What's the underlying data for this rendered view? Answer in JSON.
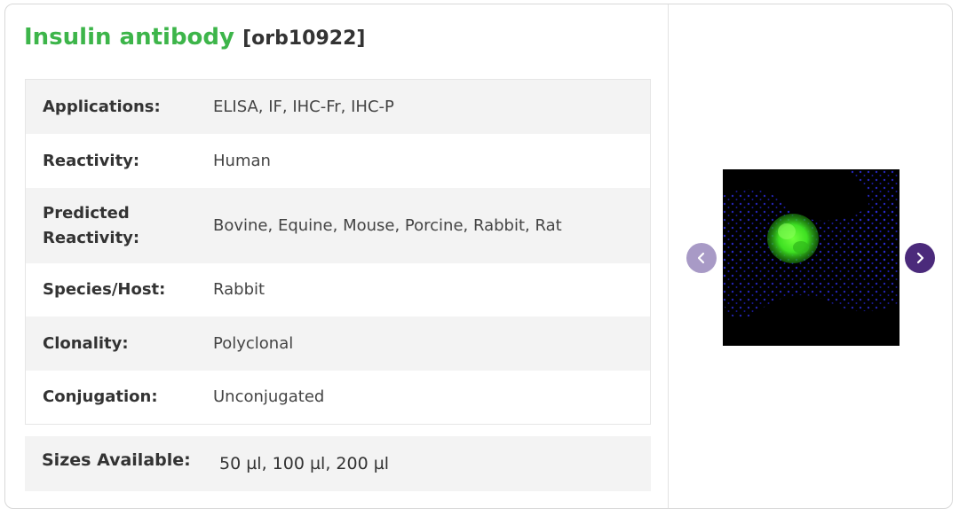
{
  "product": {
    "name": "Insulin antibody",
    "code": "[orb10922]"
  },
  "specs": [
    {
      "label": "Applications:",
      "value": "ELISA,  IF,  IHC-Fr,  IHC-P"
    },
    {
      "label": "Reactivity:",
      "value": "Human"
    },
    {
      "label": "Predicted Reactivity:",
      "value": "Bovine, Equine, Mouse, Porcine, Rabbit, Rat"
    },
    {
      "label": "Species/Host:",
      "value": "Rabbit"
    },
    {
      "label": "Clonality:",
      "value": "Polyclonal"
    },
    {
      "label": "Conjugation:",
      "value": "Unconjugated"
    }
  ],
  "sizes": {
    "label": "Sizes Available:",
    "value": "50 µl, 100 µl, 200 µl"
  },
  "gallery": {
    "prev_icon": "chevron-left-icon",
    "next_icon": "chevron-right-icon",
    "colors": {
      "prev_button": "#a89ac6",
      "next_button": "#4b2a7b",
      "title_green": "#3db54a"
    }
  }
}
